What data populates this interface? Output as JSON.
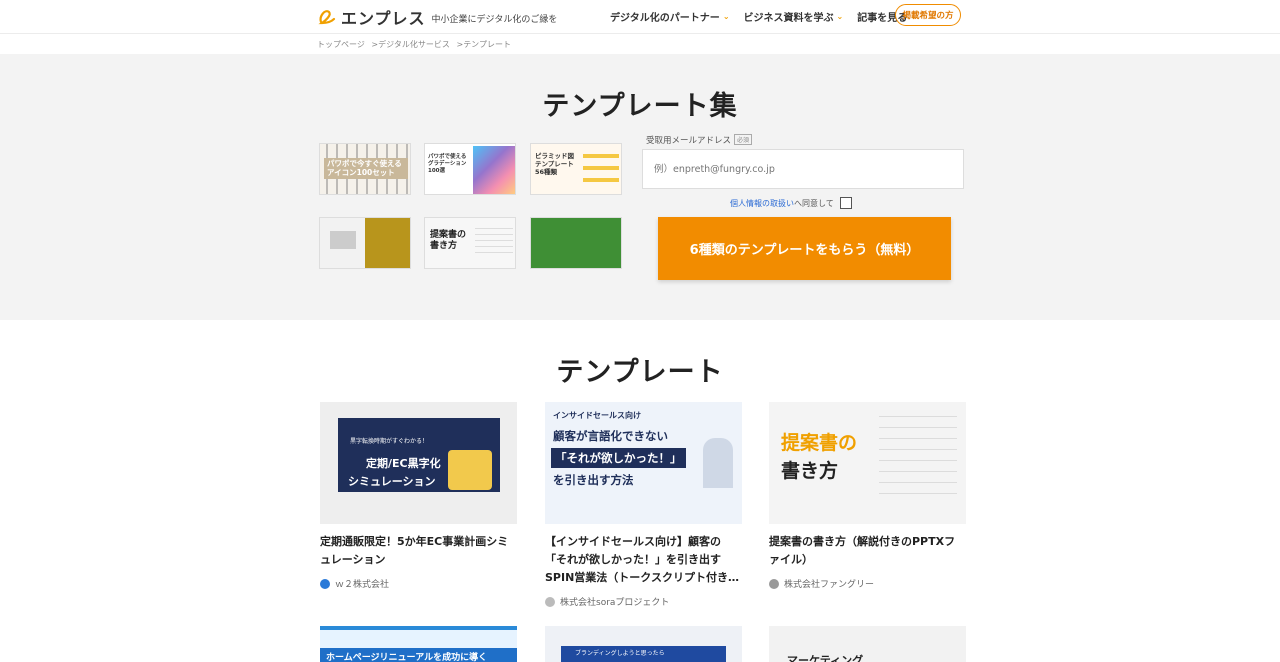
{
  "header": {
    "logo_text": "エンプレス",
    "tagline": "中小企業にデジタル化のご縁を",
    "nav": [
      {
        "label": "デジタル化のパートナー"
      },
      {
        "label": "ビジネス資料を学ぶ"
      },
      {
        "label": "記事を見る"
      }
    ],
    "cta_label": "掲載希望の方",
    "chevron": "⌄"
  },
  "breadcrumb": [
    "トップページ",
    ">デジタル化サービス",
    ">テンプレート"
  ],
  "hero": {
    "title": "テンプレート集",
    "thumbnails": [
      {
        "text": "パワポで今すぐ使える アイコン100セット"
      },
      {
        "text": "パワポで使える グラデーション 100選"
      },
      {
        "text": "ピラミッド図 テンプレート 56種類"
      },
      {
        "text": ""
      },
      {
        "text": "提案書の 書き方"
      },
      {
        "text": ""
      }
    ],
    "email_label": "受取用メールアドレス",
    "required_badge": "必須",
    "email_placeholder": "例）enpreth@fungry.co.jp",
    "privacy_link": "個人情報の取扱い",
    "privacy_suffix": "へ同意して",
    "submit_label": "6種類のテンプレートをもらう（無料）"
  },
  "section": {
    "title": "テンプレート",
    "cards": [
      {
        "img_lines": [
          "黒字転換時期がすぐわかる！",
          "定期/EC黒字化",
          "シミュレーション"
        ],
        "title": "定期通販限定！5か年EC事業計画シミュレーション",
        "company": "ｗ２株式会社",
        "icon_color": "#2a7ad8"
      },
      {
        "img_lines": [
          "インサイドセールス向け",
          "顧客が言語化できない",
          "「それが欲しかった！」",
          "を引き出す方法"
        ],
        "title": "【インサイドセールス向け】顧客の「それが欲しかった！」を引き出すSPIN営業法（トークスクリプト付き…",
        "company": "株式会社soraプロジェクト",
        "icon_color": "#bbbbbb"
      },
      {
        "img_lines": [
          "提案書の",
          "書き方"
        ],
        "title": "提案書の書き方（解説付きのPPTXファイル）",
        "company": "株式会社ファングリー",
        "icon_color": "#999999"
      }
    ],
    "next_row": [
      {
        "text": "ホームページリニューアルを成功に導く"
      },
      {
        "text": "ブランディングしようと思ったら"
      },
      {
        "text": "マーケティング"
      }
    ]
  },
  "colors": {
    "accent": "#f28c00",
    "navy": "#1f2f5a",
    "link": "#2a6ad4"
  }
}
